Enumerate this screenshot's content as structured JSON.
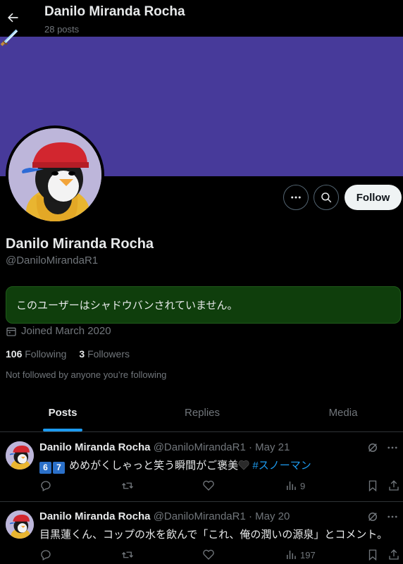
{
  "header": {
    "title": "Danilo Miranda Rocha",
    "post_count": "28 posts"
  },
  "profile": {
    "name": "Danilo Miranda Rocha",
    "handle": "@DaniloMirandaR1",
    "follow_label": "Follow",
    "notice": "このユーザーはシャドウバンされていません。",
    "joined": "Joined March 2020",
    "following_count": "106",
    "following_label": "Following",
    "followers_count": "3",
    "followers_label": "Followers",
    "not_followed": "Not followed by anyone you’re following"
  },
  "tabs": [
    {
      "label": "Posts",
      "active": true
    },
    {
      "label": "Replies",
      "active": false
    },
    {
      "label": "Media",
      "active": false
    }
  ],
  "posts": [
    {
      "name": "Danilo Miranda Rocha",
      "meta": "@DaniloMirandaR1 · May 21",
      "badges": [
        "6",
        "7"
      ],
      "text": "めめがくしゃっと笑う瞬間がご褒美",
      "hashtag": "#スノーマン",
      "views": "9"
    },
    {
      "name": "Danilo Miranda Rocha",
      "meta": "@DaniloMirandaR1 · May 20",
      "text": "目黒蓮くん、コップの水を飲んで「これ、俺の潤いの源泉」とコメント。",
      "views": "197"
    }
  ],
  "colors": {
    "banner": "#473a9a",
    "notice_bg": "#0f3e0c",
    "accent": "#1d9bf0"
  },
  "icons": [
    "back-arrow-icon",
    "sword-sticker-icon",
    "more-icon",
    "search-icon",
    "calendar-icon",
    "reply-icon",
    "repost-icon",
    "like-icon",
    "views-icon",
    "bookmark-icon",
    "share-icon",
    "grok-icon"
  ]
}
